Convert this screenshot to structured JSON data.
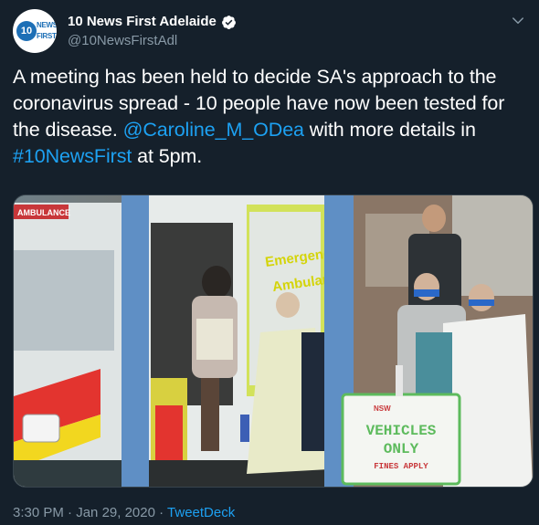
{
  "account": {
    "display_name": "10 News First Adelaide",
    "handle": "@10NewsFirstAdl",
    "avatar_number": "10",
    "avatar_text_line1": "NEWS",
    "avatar_text_line2": "FIRST"
  },
  "tweet": {
    "text_part1": "A meeting has been held to decide SA's approach to the coronavirus spread - 10 people have now been tested for the disease. ",
    "mention": "@Caroline_M_ODea",
    "text_part2": " with more details in ",
    "hashtag": "#10NewsFirst",
    "text_part3": " at 5pm."
  },
  "media": {
    "ambulance_side_text_line1": "Emergency",
    "ambulance_side_text_line2": "Ambulance",
    "ambulance_top_text": "AMBULANCE",
    "sign_line1": "VEHICLES",
    "sign_line2": "ONLY",
    "sign_line3": "FINES APPLY",
    "sign_org": "NSW"
  },
  "footer": {
    "time": "3:30 PM",
    "separator": " · ",
    "date": "Jan 29, 2020",
    "source": "TweetDeck"
  },
  "colors": {
    "background": "#15202b",
    "link": "#1da1f2",
    "secondary_text": "#8899a6"
  }
}
